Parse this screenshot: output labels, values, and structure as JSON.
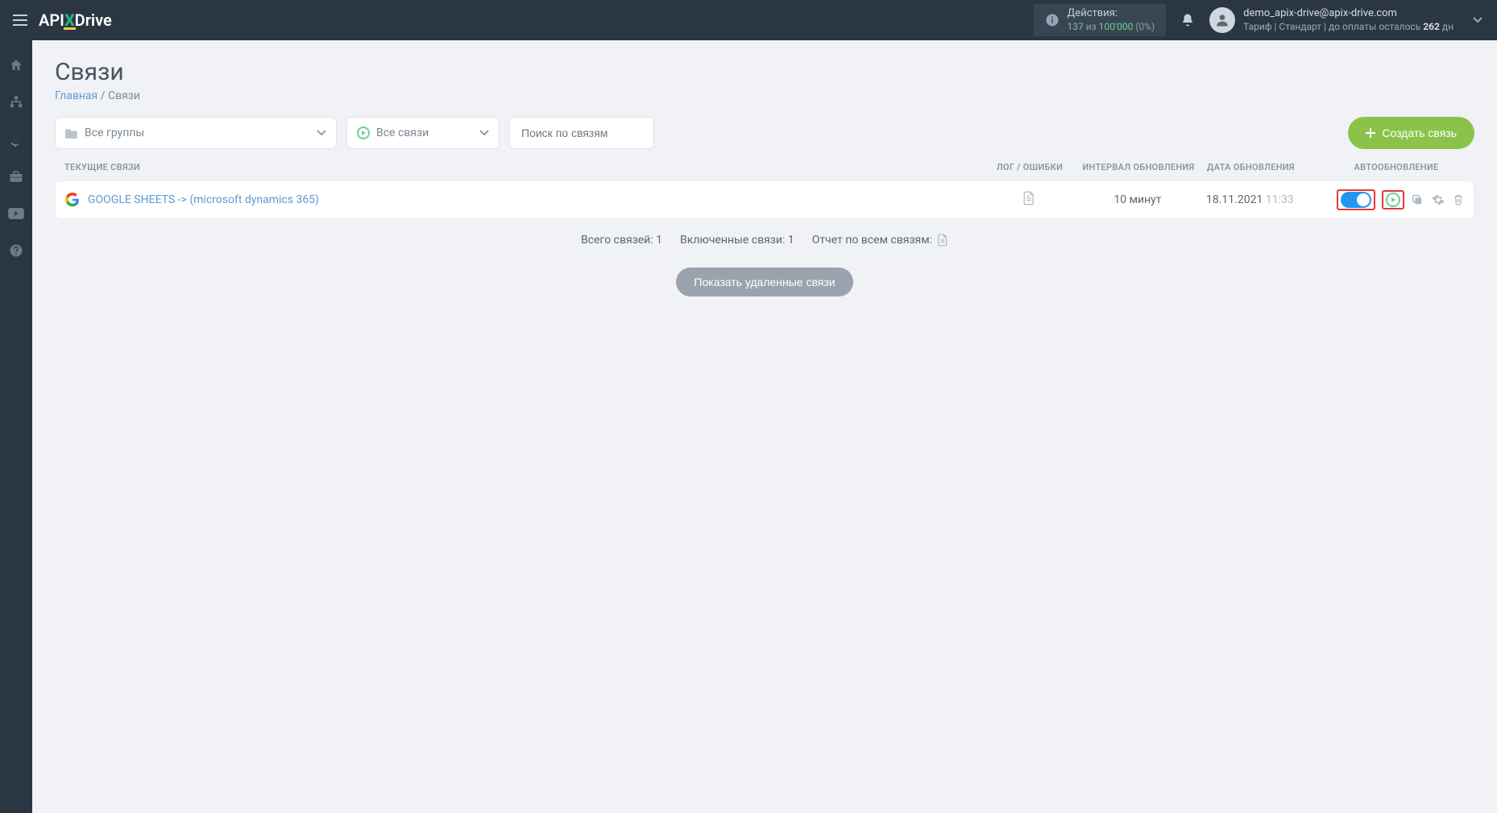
{
  "header": {
    "logo_prefix": "API",
    "logo_suffix": "Drive",
    "actions": {
      "label": "Действия:",
      "count": "137",
      "of_word": "из",
      "total": "100'000",
      "percent": "(0%)"
    },
    "user": {
      "email": "demo_apix-drive@apix-drive.com",
      "tariff_line_prefix": "Тариф | Стандарт | до оплаты осталось ",
      "days": "262",
      "days_suffix": " дн"
    }
  },
  "page": {
    "title": "Связи",
    "breadcrumb_home": "Главная",
    "breadcrumb_current": "Связи"
  },
  "filters": {
    "groups": "Все группы",
    "connections": "Все связи",
    "search_placeholder": "Поиск по связям",
    "create_button": "Создать связь"
  },
  "table": {
    "head_name": "ТЕКУЩИЕ СВЯЗИ",
    "head_log": "ЛОГ / ОШИБКИ",
    "head_interval": "ИНТЕРВАЛ ОБНОВЛЕНИЯ",
    "head_date": "ДАТА ОБНОВЛЕНИЯ",
    "head_auto": "АВТООБНОВЛЕНИЕ",
    "row": {
      "name": "GOOGLE SHEETS -> (microsoft dynamics 365)",
      "interval": "10 минут",
      "date": "18.11.2021",
      "time": "11:33"
    }
  },
  "summary": {
    "total_label": "Всего связей:",
    "total_value": "1",
    "enabled_label": "Включенные связи:",
    "enabled_value": "1",
    "report_label": "Отчет по всем связям:"
  },
  "deleted_button": "Показать удаленные связи"
}
